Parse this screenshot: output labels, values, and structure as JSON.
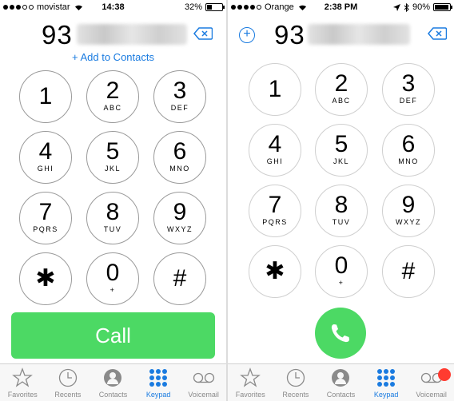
{
  "left": {
    "status": {
      "carrier": "movistar",
      "time": "14:38",
      "battery": "32%",
      "battery_level": 0.32
    },
    "number_prefix": "93",
    "add_to_contacts": "+ Add to Contacts",
    "keys": [
      {
        "digit": "1",
        "letters": ""
      },
      {
        "digit": "2",
        "letters": "ABC"
      },
      {
        "digit": "3",
        "letters": "DEF"
      },
      {
        "digit": "4",
        "letters": "GHI"
      },
      {
        "digit": "5",
        "letters": "JKL"
      },
      {
        "digit": "6",
        "letters": "MNO"
      },
      {
        "digit": "7",
        "letters": "PQRS"
      },
      {
        "digit": "8",
        "letters": "TUV"
      },
      {
        "digit": "9",
        "letters": "WXYZ"
      },
      {
        "digit": "✱",
        "letters": ""
      },
      {
        "digit": "0",
        "letters": "+"
      },
      {
        "digit": "#",
        "letters": ""
      }
    ],
    "call_label": "Call",
    "tabs": [
      "Favorites",
      "Recents",
      "Contacts",
      "Keypad",
      "Voicemail"
    ]
  },
  "right": {
    "status": {
      "carrier": "Orange",
      "time": "2:38 PM",
      "battery": "90%",
      "battery_level": 0.9
    },
    "number_prefix": "93",
    "keys": [
      {
        "digit": "1",
        "letters": ""
      },
      {
        "digit": "2",
        "letters": "ABC"
      },
      {
        "digit": "3",
        "letters": "DEF"
      },
      {
        "digit": "4",
        "letters": "GHI"
      },
      {
        "digit": "5",
        "letters": "JKL"
      },
      {
        "digit": "6",
        "letters": "MNO"
      },
      {
        "digit": "7",
        "letters": "PQRS"
      },
      {
        "digit": "8",
        "letters": "TUV"
      },
      {
        "digit": "9",
        "letters": "WXYZ"
      },
      {
        "digit": "✱",
        "letters": ""
      },
      {
        "digit": "0",
        "letters": "+"
      },
      {
        "digit": "#",
        "letters": ""
      }
    ],
    "tabs": [
      "Favorites",
      "Recents",
      "Contacts",
      "Keypad",
      "Voicemail"
    ]
  },
  "colors": {
    "accent": "#1a7be0",
    "call_green": "#4cd964",
    "badge_red": "#ff3b30"
  }
}
